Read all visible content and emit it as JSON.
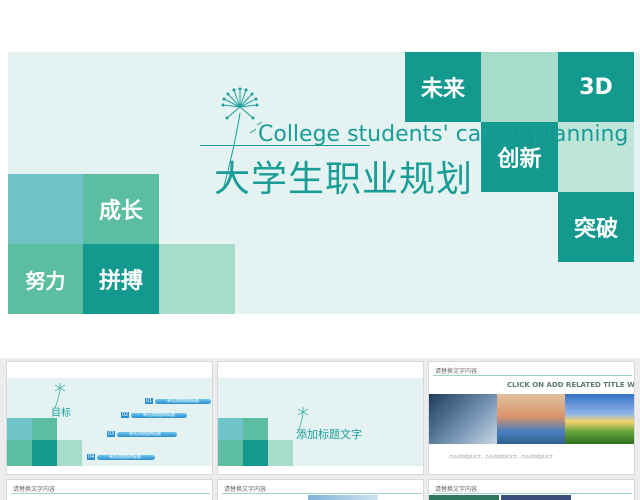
{
  "hero": {
    "title_en": "College students' career planning",
    "title_cn": "大学生职业规划",
    "tiles": {
      "future": "未来",
      "three_d": "3D",
      "innovate": "创新",
      "breakthrough": "突破",
      "growth": "成长",
      "effort": "努力",
      "struggle": "拼搏"
    }
  },
  "thumbnails": {
    "slide1": {
      "heading": "目标",
      "rows": [
        {
          "num": "01",
          "text": "单击添加您的标题"
        },
        {
          "num": "02",
          "text": "单击添加您的标题"
        },
        {
          "num": "03",
          "text": "单击添加您的标题"
        },
        {
          "num": "04",
          "text": "单击添加您的标题"
        }
      ]
    },
    "slide2": {
      "heading": "添加标题文字"
    },
    "slide3": {
      "top_label": "请替换文字内容",
      "banner": "CLICK ON ADD RELATED TITLE WORDS",
      "caption": "点击添加相关文字，点击添加相关文字，点击添加相关文字"
    },
    "slide4": {
      "top_label": "请替换文字内容"
    },
    "slide5": {
      "top_label": "请替换文字内容"
    },
    "slide6": {
      "top_label": "请替换文字内容"
    }
  },
  "colors": {
    "teal_dark": "#14998e",
    "teal_mid": "#5bbea0",
    "teal_light": "#a7dccb",
    "band": "#e4f3f1"
  }
}
